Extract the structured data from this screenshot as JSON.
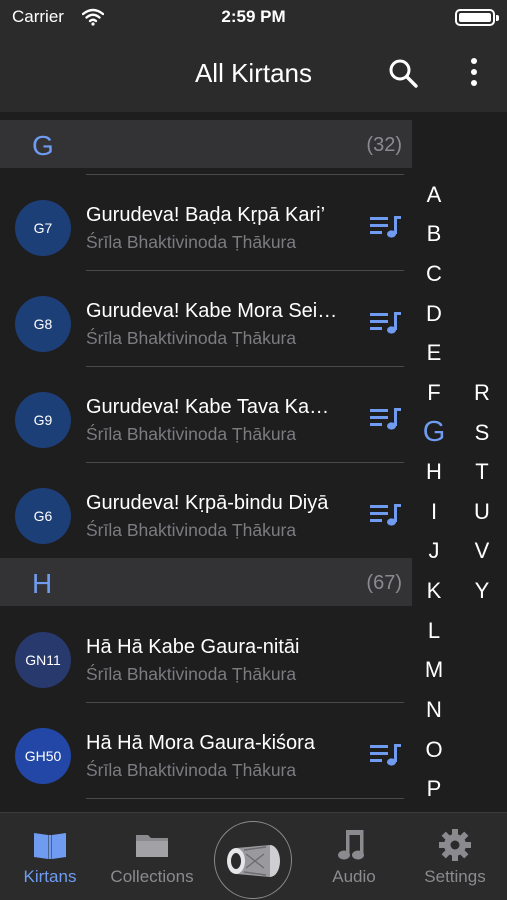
{
  "status_bar": {
    "carrier": "Carrier",
    "time": "2:59 PM"
  },
  "header": {
    "title": "All Kirtans"
  },
  "sections": [
    {
      "letter": "G",
      "count": "(32)",
      "items": [
        {
          "code": "G7",
          "title": "Gurudeva! Baḍa Kṛpā Kari’",
          "author": "Śrīla Bhaktivinoda Ṭhākura",
          "queue_icon": "playlist-music-icon"
        },
        {
          "code": "G8",
          "title": "Gurudeva! Kabe Mora Sei…",
          "author": "Śrīla Bhaktivinoda Ṭhākura",
          "queue_icon": "playlist-music-icon"
        },
        {
          "code": "G9",
          "title": "Gurudeva! Kabe Tava Ka…",
          "author": "Śrīla Bhaktivinoda Ṭhākura",
          "queue_icon": "playlist-music-icon"
        },
        {
          "code": "G6",
          "title": "Gurudeva! Kṛpā-bindu Diyā",
          "author": "Śrīla Bhaktivinoda Ṭhākura",
          "queue_icon": "playlist-music-icon"
        }
      ]
    },
    {
      "letter": "H",
      "count": "(67)",
      "items": [
        {
          "code": "GN11",
          "title": "Hā Hā Kabe Gaura-nitāi",
          "author": "Śrīla Bhaktivinoda Ṭhākura"
        },
        {
          "code": "GH50",
          "title": "Hā Hā Mora Gaura-kiśora",
          "author": "Śrīla Bhaktivinoda Ṭhākura",
          "queue_icon": "playlist-music-icon"
        }
      ]
    }
  ],
  "index_col1": [
    "A",
    "B",
    "C",
    "D",
    "E",
    "F",
    "G",
    "H",
    "I",
    "J",
    "K",
    "L",
    "M",
    "N",
    "O",
    "P"
  ],
  "index_col2": [
    "R",
    "S",
    "T",
    "U",
    "V",
    "Y"
  ],
  "index_active": "G",
  "tabs": [
    {
      "label": "Kirtans",
      "icon": "book-icon",
      "active": true
    },
    {
      "label": "Collections",
      "icon": "folder-icon",
      "active": false
    },
    {
      "label": "Audio",
      "icon": "music-note-icon",
      "active": false
    },
    {
      "label": "Settings",
      "icon": "gear-icon",
      "active": false
    }
  ],
  "center_button": {
    "icon": "mridanga-drum-icon"
  },
  "colors": {
    "accent": "#6f9bf1",
    "background": "#1e1e1f",
    "bar": "#2b2b2c",
    "section_header": "#333335",
    "badge": "#1d3f77"
  }
}
